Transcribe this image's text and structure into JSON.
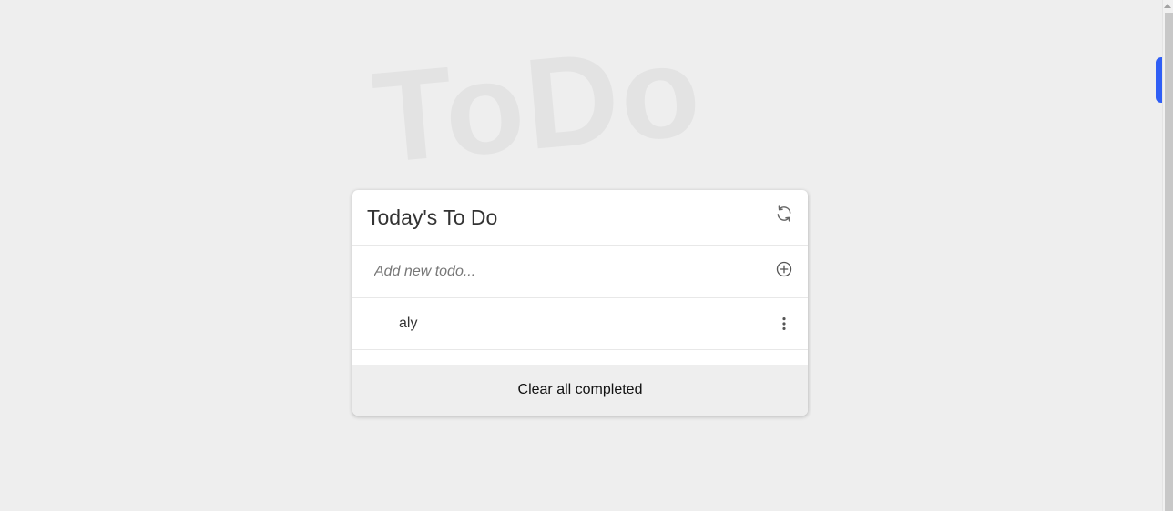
{
  "watermark": {
    "text": "ToDo"
  },
  "card": {
    "title": "Today's To Do",
    "refresh_icon": "refresh-icon",
    "add_input": {
      "value": "",
      "placeholder": "Add new todo..."
    },
    "add_icon": "plus-circle-icon",
    "items": [
      {
        "label": "aly",
        "menu_icon": "more-vertical-icon"
      }
    ],
    "footer": {
      "clear_label": "Clear all completed"
    }
  },
  "colors": {
    "background": "#eeeeee",
    "card": "#ffffff",
    "accent": "#2f5ef5",
    "text": "#333333"
  }
}
